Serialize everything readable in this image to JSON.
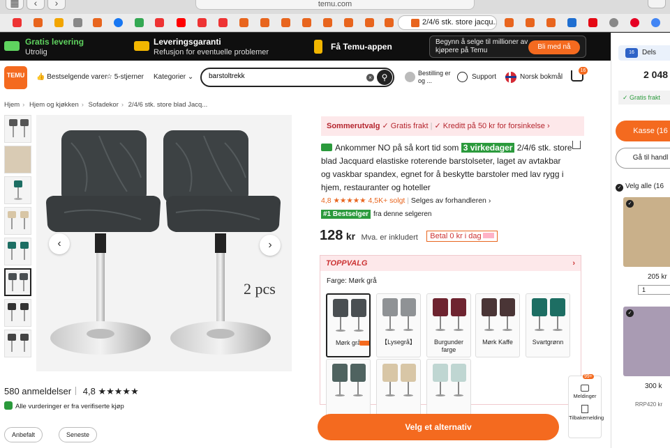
{
  "browser": {
    "url": "temu.com",
    "active_tab_title": "2/4/6 stk. store jacqu..."
  },
  "promo": {
    "shipping_title": "Gratis levering",
    "shipping_sub": "Utrolig",
    "guarantee_title": "Leveringsgaranti",
    "guarantee_sub": "Refusjon for eventuelle problemer",
    "app_title": "Få Temu-appen",
    "seller_text": "Begynn å selge til millioner av kjøpere på Temu",
    "seller_button": "Bli med nå"
  },
  "header": {
    "logo_line1": "TEMU",
    "nav": [
      "Bestselgende varer",
      "5-stjerner",
      "Kategorier"
    ],
    "search_value": "barstoltrekk",
    "account": "Bestilling er og ...",
    "support": "Support",
    "language": "Norsk bokmål",
    "cart_count": "16"
  },
  "breadcrumb": [
    "Hjem",
    "Hjem og kjøkken",
    "Sofadekor",
    "2/4/6 stk. store blad Jacq..."
  ],
  "gallery": {
    "overlay_text": "2 pcs",
    "prev_icon": "‹",
    "next_icon": "›"
  },
  "reviews": {
    "count": "580 anmeldelser",
    "rating": "4,8",
    "stars": "★★★★★",
    "verified": "Alle vurderinger er fra verifiserte kjøp",
    "sort_buttons": [
      "Anbefalt",
      "Seneste"
    ]
  },
  "product": {
    "summer_label": "Sommerutvalg",
    "summer_free": "✓ Gratis frakt",
    "summer_credit": "✓ Kreditt på 50 kr for forsinkelse ›",
    "arrival_prefix": "Ankommer NO på så kort tid som",
    "arrival_days": "3 virkedager",
    "title": "2/4/6 stk. store blad Jacquard elastiske roterende barstolseter, laget av avtakbar og vaskbar spandex, egnet for å beskytte barstoler med lav rygg i hjem, restauranter og hoteller",
    "rating_text": "4,8 ★★★★★ 4,5K+ solgt",
    "sold_by": "Selges av forhandleren",
    "bestseller_badge": "#1 Bestselger",
    "bestseller_text": "fra denne selgeren",
    "price": "128",
    "price_unit": "kr",
    "vat": "Mva. er inkludert",
    "pay_later": "Betal 0 kr i dag"
  },
  "options": {
    "header": "TOPPVALG",
    "color_label": "Farge: Mørk grå",
    "swatches": [
      {
        "label": "Mørk grå",
        "color": "#4a4f52"
      },
      {
        "label": "【Lysegrå】",
        "color": "#8f9295"
      },
      {
        "label": "Burgunder farge",
        "color": "#6e2430"
      },
      {
        "label": "Mørk Kaffe",
        "color": "#4a3536"
      },
      {
        "label": "Svartgrønn",
        "color": "#1d6e63"
      },
      {
        "label": "",
        "color": "#4f6360"
      },
      {
        "label": "",
        "color": "#d8c6a6"
      },
      {
        "label": "",
        "color": "#bfd6d2"
      }
    ]
  },
  "floating": {
    "messages_badge": "99+",
    "messages": "Meldinger",
    "feedback": "Tilbakemelding"
  },
  "cta": "Velg et alternativ",
  "cart_sidebar": {
    "label": "Dels",
    "icon_count": "16",
    "total": "2 048",
    "free_shipping": "✓ Gratis frakt",
    "checkout": "Kasse (16",
    "go_to": "Gå til handl",
    "select_all": "Velg alle (16",
    "item1_price": "205 kr",
    "item1_qty": "1",
    "item2_price": "300 k",
    "item2_rrp": "RRP420 kr"
  }
}
